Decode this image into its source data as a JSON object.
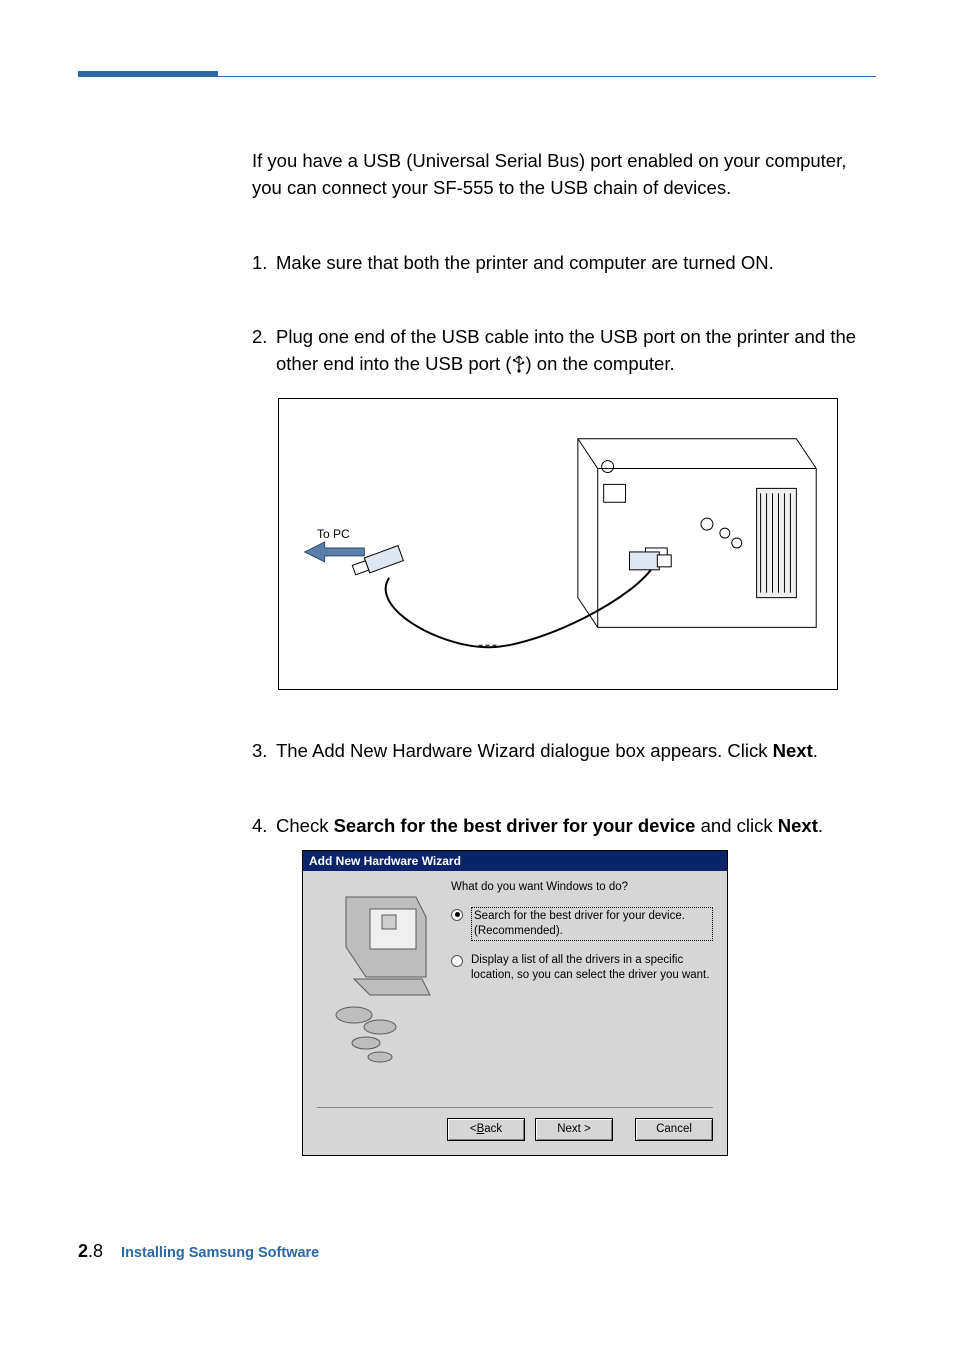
{
  "intro": "If you have a USB (Universal Serial Bus) port enabled on your computer, you can connect your SF-555 to the USB chain of devices.",
  "steps": {
    "s1": {
      "num": "1.",
      "text": "Make sure that both the printer and computer are turned ON."
    },
    "s2": {
      "num": "2.",
      "text_a": "Plug one end of the USB cable into the USB port on the printer and the other end into the USB port (",
      "text_b": ") on the computer."
    },
    "s3": {
      "num": "3.",
      "text_a": "The Add New Hardware Wizard dialogue box appears. Click ",
      "bold": "Next",
      "text_b": "."
    },
    "s4": {
      "num": "4.",
      "text_a": "Check ",
      "bold1": "Search for the best driver for your device",
      "text_mid": " and click ",
      "bold2": "Next",
      "text_b": "."
    }
  },
  "figure1": {
    "label": "To PC"
  },
  "wizard": {
    "title": "Add New Hardware Wizard",
    "question": "What do you want Windows to do?",
    "opt1": "Search for the best driver for your device. (Recommended).",
    "opt2": "Display a list of all the drivers in a specific location, so you can select the driver you want.",
    "buttons": {
      "back_pre": "< ",
      "back_u": "B",
      "back_post": "ack",
      "next": "Next >",
      "cancel": "Cancel"
    }
  },
  "footer": {
    "chapter": "2",
    "dot": ".",
    "page": "8",
    "title": "Installing Samsung Software"
  }
}
